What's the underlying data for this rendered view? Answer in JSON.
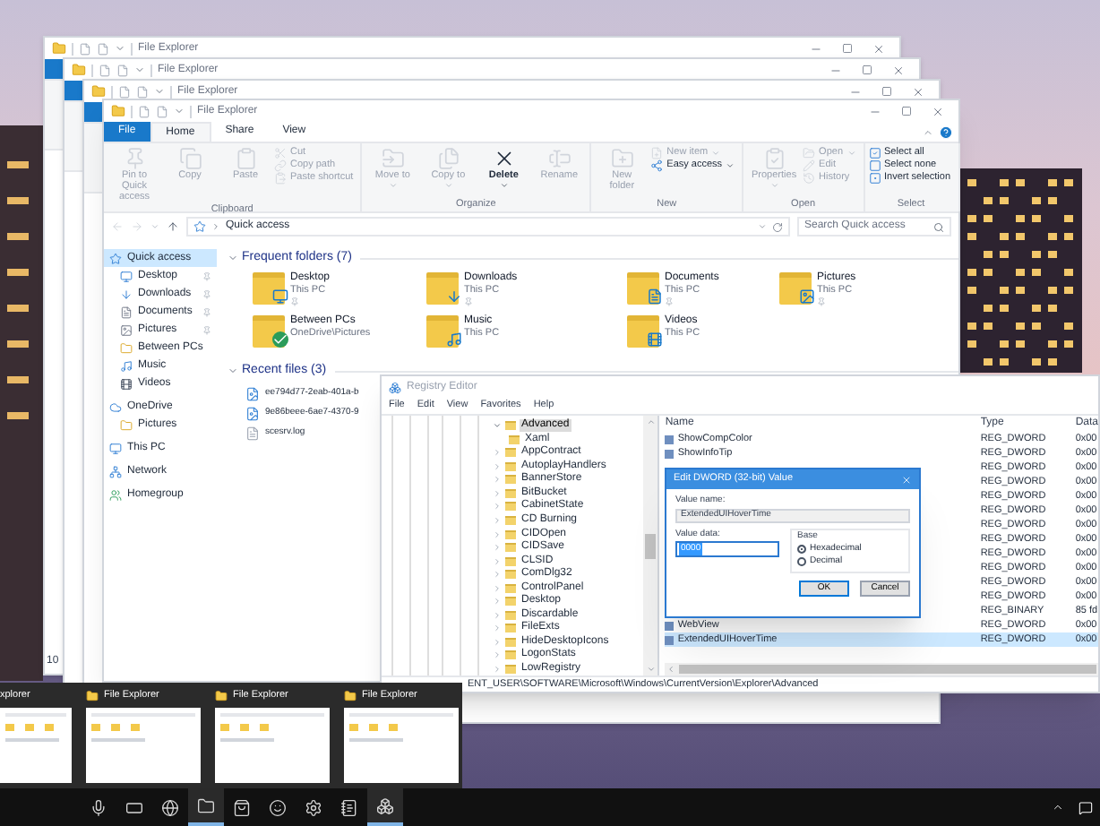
{
  "background_windows": [
    {
      "title": "File Explorer",
      "status": "10"
    },
    {
      "title": "File Explorer"
    },
    {
      "title": "File Explorer"
    }
  ],
  "explorer": {
    "title": "File Explorer",
    "tabs": [
      {
        "label": "File",
        "kind": "file",
        "selected": false
      },
      {
        "label": "Home",
        "kind": "tab",
        "selected": true
      },
      {
        "label": "Share",
        "kind": "tab",
        "selected": false
      },
      {
        "label": "View",
        "kind": "tab",
        "selected": false
      }
    ],
    "ribbon": [
      {
        "label": "Clipboard",
        "large": [
          {
            "label": "Pin to Quick access",
            "disabled": true
          },
          {
            "label": "Copy",
            "disabled": true
          },
          {
            "label": "Paste",
            "disabled": true
          }
        ],
        "small": [
          {
            "label": "Cut",
            "disabled": true
          },
          {
            "label": "Copy path",
            "disabled": true
          },
          {
            "label": "Paste shortcut",
            "disabled": true
          }
        ]
      },
      {
        "label": "Organize",
        "large": [
          {
            "label": "Move to",
            "disabled": true,
            "dropdown": true
          },
          {
            "label": "Copy to",
            "disabled": true,
            "dropdown": true
          },
          {
            "label": "Delete",
            "disabled": false,
            "dropdown": true
          },
          {
            "label": "Rename",
            "disabled": true
          }
        ]
      },
      {
        "label": "New",
        "large": [
          {
            "label": "New folder",
            "disabled": true
          }
        ],
        "small": [
          {
            "label": "New item",
            "disabled": true,
            "dropdown": true
          },
          {
            "label": "Easy access",
            "disabled": false,
            "dropdown": true
          }
        ]
      },
      {
        "label": "Open",
        "large": [
          {
            "label": "Properties",
            "disabled": true,
            "dropdown": true
          }
        ],
        "small": [
          {
            "label": "Open",
            "disabled": true,
            "dropdown": true
          },
          {
            "label": "Edit",
            "disabled": true
          },
          {
            "label": "History",
            "disabled": true
          }
        ]
      },
      {
        "label": "Select",
        "small": [
          {
            "label": "Select all",
            "disabled": false
          },
          {
            "label": "Select none",
            "disabled": false
          },
          {
            "label": "Invert selection",
            "disabled": false
          }
        ]
      }
    ],
    "address": "Quick access",
    "search": {
      "placeholder": "Search Quick access"
    },
    "sidebar": [
      {
        "label": "Quick access",
        "kind": "header",
        "selected": true,
        "pinned": false
      },
      {
        "label": "Desktop",
        "kind": "child",
        "selected": false,
        "pinned": true
      },
      {
        "label": "Downloads",
        "kind": "child",
        "selected": false,
        "pinned": true
      },
      {
        "label": "Documents",
        "kind": "child",
        "selected": false,
        "pinned": true
      },
      {
        "label": "Pictures",
        "kind": "child",
        "selected": false,
        "pinned": true
      },
      {
        "label": "Between PCs",
        "kind": "child",
        "selected": false,
        "pinned": false
      },
      {
        "label": "Music",
        "kind": "child",
        "selected": false,
        "pinned": false
      },
      {
        "label": "Videos",
        "kind": "child",
        "selected": false,
        "pinned": false
      },
      {
        "label": "OneDrive",
        "kind": "header",
        "selected": false,
        "pinned": false
      },
      {
        "label": "Pictures",
        "kind": "child",
        "selected": false,
        "pinned": false
      },
      {
        "label": "This PC",
        "kind": "header",
        "selected": false,
        "pinned": false
      },
      {
        "label": "Network",
        "kind": "header",
        "selected": false,
        "pinned": false
      },
      {
        "label": "Homegroup",
        "kind": "header",
        "selected": false,
        "pinned": false
      }
    ],
    "frequent": {
      "heading": "Frequent folders (7)",
      "expanded": true,
      "items": [
        {
          "name": "Desktop",
          "location": "This PC",
          "pinned": true
        },
        {
          "name": "Downloads",
          "location": "This PC",
          "pinned": true
        },
        {
          "name": "Documents",
          "location": "This PC",
          "pinned": true
        },
        {
          "name": "Pictures",
          "location": "This PC",
          "pinned": true
        },
        {
          "name": "Between PCs",
          "location": "OneDrive\\Pictures",
          "pinned": false
        },
        {
          "name": "Music",
          "location": "This PC",
          "pinned": false
        },
        {
          "name": "Videos",
          "location": "This PC",
          "pinned": false
        }
      ]
    },
    "recent": {
      "heading": "Recent files (3)",
      "expanded": true,
      "items": [
        "ee794d77-2eab-401a-b",
        "9e86beee-6ae7-4370-9",
        "scesrv.log"
      ]
    }
  },
  "registry": {
    "title": "Registry Editor",
    "menu": [
      "File",
      "Edit",
      "View",
      "Favorites",
      "Help"
    ],
    "tree": [
      {
        "label": "Advanced",
        "expanded": true,
        "selected": true,
        "children": [
          {
            "label": "Xaml"
          }
        ]
      },
      {
        "label": "AppContract",
        "expanded": false,
        "selected": false
      },
      {
        "label": "AutoplayHandlers",
        "expanded": false,
        "selected": false
      },
      {
        "label": "BannerStore",
        "expanded": false,
        "selected": false
      },
      {
        "label": "BitBucket",
        "expanded": false,
        "selected": false
      },
      {
        "label": "CabinetState",
        "expanded": false,
        "selected": false
      },
      {
        "label": "CD Burning",
        "expanded": false,
        "selected": false
      },
      {
        "label": "CIDOpen",
        "expanded": false,
        "selected": false
      },
      {
        "label": "CIDSave",
        "expanded": false,
        "selected": false
      },
      {
        "label": "CLSID",
        "expanded": false,
        "selected": false
      },
      {
        "label": "ComDlg32",
        "expanded": false,
        "selected": false
      },
      {
        "label": "ControlPanel",
        "expanded": false,
        "selected": false
      },
      {
        "label": "Desktop",
        "expanded": false,
        "selected": false
      },
      {
        "label": "Discardable",
        "expanded": false,
        "selected": false
      },
      {
        "label": "FileExts",
        "expanded": false,
        "selected": false
      },
      {
        "label": "HideDesktopIcons",
        "expanded": false,
        "selected": false
      },
      {
        "label": "LogonStats",
        "expanded": false,
        "selected": false
      },
      {
        "label": "LowRegistry",
        "expanded": false,
        "selected": false
      }
    ],
    "columns": [
      "Name",
      "Type",
      "Data"
    ],
    "rows": [
      {
        "name": "ShowCompColor",
        "type": "REG_DWORD",
        "data": "0x00",
        "selected": false
      },
      {
        "name": "ShowInfoTip",
        "type": "REG_DWORD",
        "data": "0x00",
        "selected": false
      },
      {
        "type": "REG_DWORD",
        "data": "0x00",
        "selected": false
      },
      {
        "type": "REG_DWORD",
        "data": "0x00",
        "selected": false
      },
      {
        "type": "REG_DWORD",
        "data": "0x00",
        "selected": false
      },
      {
        "type": "REG_DWORD",
        "data": "0x00",
        "selected": false
      },
      {
        "type": "REG_DWORD",
        "data": "0x00",
        "selected": false
      },
      {
        "type": "REG_DWORD",
        "data": "0x00",
        "selected": false
      },
      {
        "type": "REG_DWORD",
        "data": "0x00",
        "selected": false
      },
      {
        "type": "REG_DWORD",
        "data": "0x00",
        "selected": false
      },
      {
        "type": "REG_DWORD",
        "data": "0x00",
        "selected": false
      },
      {
        "type": "REG_DWORD",
        "data": "0x00",
        "selected": false
      },
      {
        "type": "REG_BINARY",
        "data": "85 fd",
        "selected": false
      },
      {
        "name": "WebView",
        "type": "REG_DWORD",
        "data": "0x00",
        "selected": false
      },
      {
        "name": "ExtendedUIHoverTime",
        "type": "REG_DWORD",
        "data": "0x00",
        "selected": true
      }
    ],
    "status": "ENT_USER\\SOFTWARE\\Microsoft\\Windows\\CurrentVersion\\Explorer\\Advanced"
  },
  "dword_dialog": {
    "title": "Edit DWORD (32-bit) Value",
    "name_label": "Value name:",
    "name_value": "ExtendedUIHoverTime",
    "data_label": "Value data:",
    "data_value": "0000",
    "base_label": "Base",
    "bases": [
      {
        "label": "Hexadecimal",
        "selected": true
      },
      {
        "label": "Decimal",
        "selected": false
      }
    ],
    "buttons": [
      {
        "label": "OK",
        "default": true
      },
      {
        "label": "Cancel",
        "default": false
      }
    ]
  },
  "taskbar_previews": [
    {
      "title": "xplorer",
      "kind": "partial"
    },
    {
      "title": "File Explorer",
      "kind": "full"
    },
    {
      "title": "File Explorer",
      "kind": "full"
    },
    {
      "title": "File Explorer",
      "kind": "full"
    }
  ],
  "taskbar": [
    {
      "running": false
    },
    {
      "running": false
    },
    {
      "running": false
    },
    {
      "running": true
    },
    {
      "running": false
    },
    {
      "running": false
    },
    {
      "running": false
    },
    {
      "running": false
    },
    {
      "running": true
    }
  ]
}
